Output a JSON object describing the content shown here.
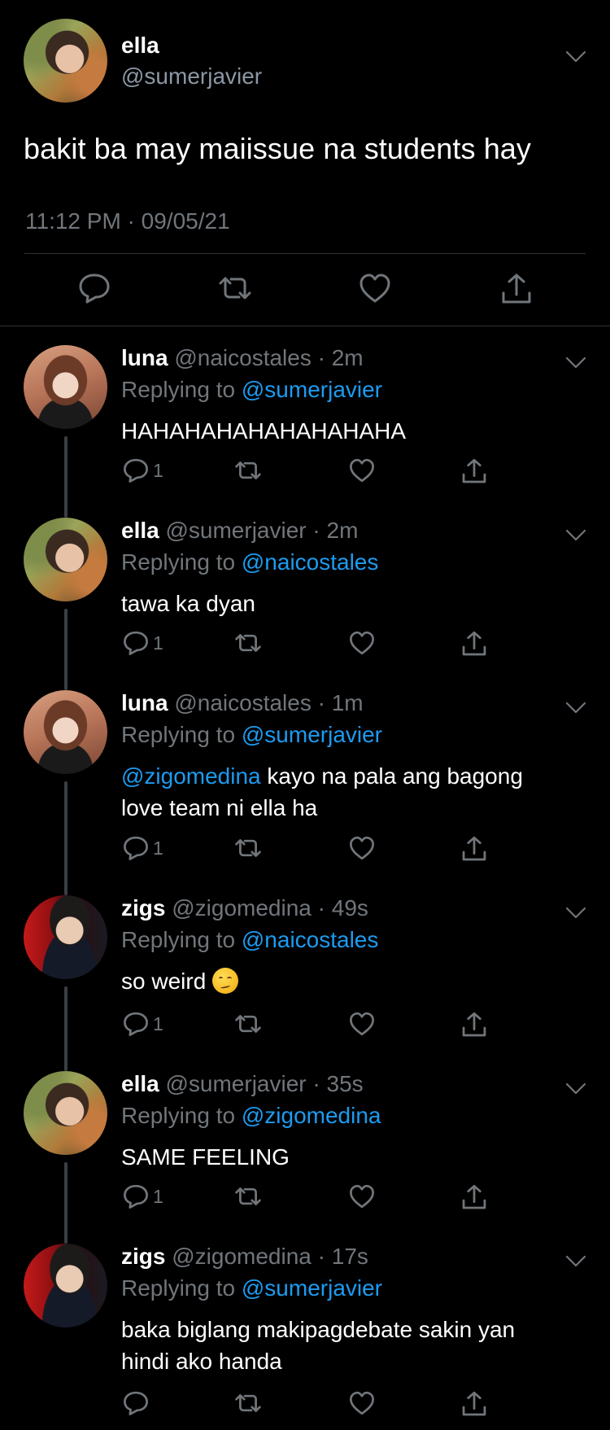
{
  "main_tweet": {
    "name": "ella",
    "handle": "@sumerjavier",
    "text": "bakit ba may maiissue na students hay",
    "timestamp": "11:12 PM · 09/05/21"
  },
  "replies": [
    {
      "name": "luna",
      "meta": "@naicostales · 2m",
      "replying_prefix": "Replying to ",
      "replying_to": "@sumerjavier",
      "body_mention": "",
      "body_line1": "HAHAHAHAHAHAHAHAHA",
      "body_line2": "",
      "reply_count": "1"
    },
    {
      "name": "ella",
      "meta": "@sumerjavier · 2m",
      "replying_prefix": "Replying to ",
      "replying_to": "@naicostales",
      "body_mention": "",
      "body_line1": "tawa ka dyan",
      "body_line2": "",
      "reply_count": "1"
    },
    {
      "name": "luna",
      "meta": "@naicostales · 1m",
      "replying_prefix": "Replying to ",
      "replying_to": "@sumerjavier",
      "body_mention": "@zigomedina",
      "body_line1": " kayo na pala ang bagong",
      "body_line2": "love team ni ella ha",
      "reply_count": "1"
    },
    {
      "name": "zigs",
      "meta": "@zigomedina · 49s",
      "replying_prefix": "Replying to ",
      "replying_to": "@naicostales",
      "body_mention": "",
      "body_line1": "so weird",
      "body_line2": "",
      "emoji": "woozy-face",
      "reply_count": "1"
    },
    {
      "name": "ella",
      "meta": "@sumerjavier · 35s",
      "replying_prefix": "Replying to ",
      "replying_to": "@zigomedina",
      "body_mention": "",
      "body_line1": "SAME FEELING",
      "body_line2": "",
      "reply_count": "1"
    },
    {
      "name": "zigs",
      "meta": "@zigomedina · 17s",
      "replying_prefix": "Replying to ",
      "replying_to": "@sumerjavier",
      "body_mention": "",
      "body_line1": "baka biglang makipagdebate sakin yan",
      "body_line2": "hindi ako handa",
      "reply_count": ""
    }
  ],
  "colors": {
    "background": "#000000",
    "text": "#ffffff",
    "secondary": "#71767b",
    "link": "#1d9bf0",
    "divider": "#2f3336"
  },
  "icons": [
    "reply-icon",
    "retweet-icon",
    "like-icon",
    "share-icon",
    "chevron-down-icon"
  ]
}
